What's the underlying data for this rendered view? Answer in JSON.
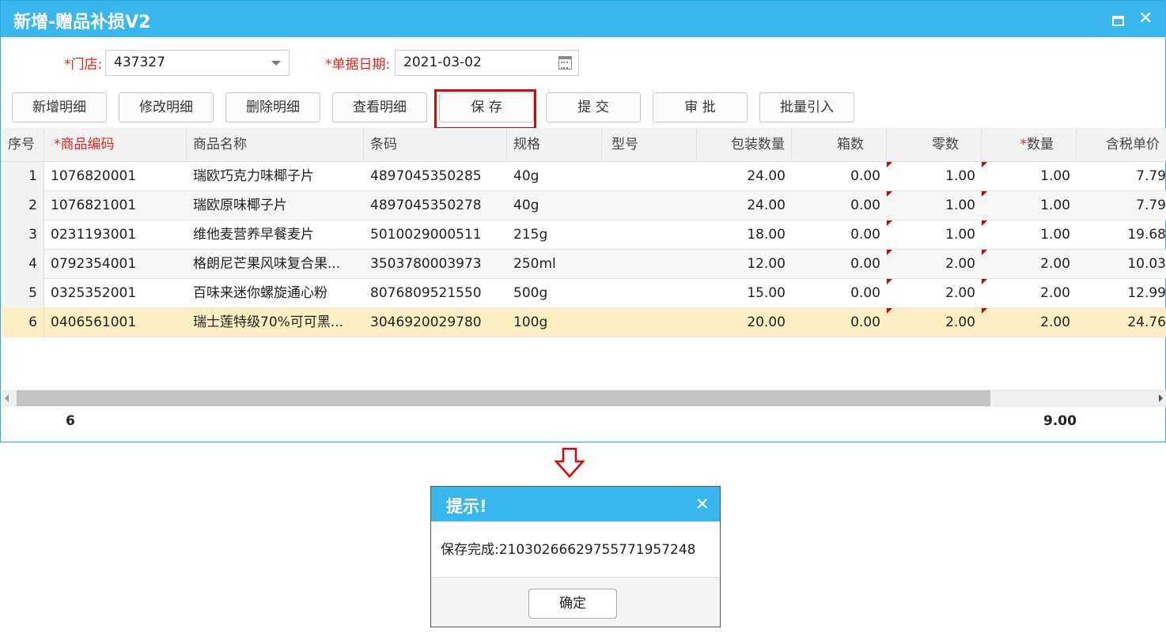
{
  "window": {
    "title": "新增-赠品补损V2"
  },
  "form": {
    "store_label": "门店:",
    "store_value": "437327",
    "date_label": "单据日期:",
    "date_value": "2021-03-02",
    "required_mark": "*"
  },
  "toolbar": {
    "add": "新增明细",
    "edit": "修改明细",
    "delete": "删除明细",
    "view": "查看明细",
    "save": "保 存",
    "submit": "提 交",
    "approve": "审 批",
    "import": "批量引入"
  },
  "grid": {
    "headers": {
      "idx": "序号",
      "code": "商品编码",
      "name": "商品名称",
      "barcode": "条码",
      "spec": "规格",
      "model": "型号",
      "pack": "包装数量",
      "box": "箱数",
      "loose": "零数",
      "qty": "数量",
      "price": "含税单价"
    },
    "rows": [
      {
        "idx": "1",
        "code": "1076820001",
        "name": "瑞欧巧克力味椰子片",
        "barcode": "4897045350285",
        "spec": "40g",
        "model": "",
        "pack": "24.00",
        "box": "0.00",
        "loose": "1.00",
        "qty": "1.00",
        "price": "7.79"
      },
      {
        "idx": "2",
        "code": "1076821001",
        "name": "瑞欧原味椰子片",
        "barcode": "4897045350278",
        "spec": "40g",
        "model": "",
        "pack": "24.00",
        "box": "0.00",
        "loose": "1.00",
        "qty": "1.00",
        "price": "7.79"
      },
      {
        "idx": "3",
        "code": "0231193001",
        "name": "维他麦营养早餐麦片",
        "barcode": "5010029000511",
        "spec": "215g",
        "model": "",
        "pack": "18.00",
        "box": "0.00",
        "loose": "1.00",
        "qty": "1.00",
        "price": "19.68"
      },
      {
        "idx": "4",
        "code": "0792354001",
        "name": "格朗尼芒果风味复合果...",
        "barcode": "3503780003973",
        "spec": "250ml",
        "model": "",
        "pack": "12.00",
        "box": "0.00",
        "loose": "2.00",
        "qty": "2.00",
        "price": "10.03"
      },
      {
        "idx": "5",
        "code": "0325352001",
        "name": "百味来迷你螺旋通心粉",
        "barcode": "8076809521550",
        "spec": "500g",
        "model": "",
        "pack": "15.00",
        "box": "0.00",
        "loose": "2.00",
        "qty": "2.00",
        "price": "12.99"
      },
      {
        "idx": "6",
        "code": "0406561001",
        "name": "瑞士莲特级70%可可黑...",
        "barcode": "3046920029780",
        "spec": "100g",
        "model": "",
        "pack": "20.00",
        "box": "0.00",
        "loose": "2.00",
        "qty": "2.00",
        "price": "24.76"
      }
    ],
    "footer": {
      "count": "6",
      "qty_total": "9.00"
    }
  },
  "dialog": {
    "title": "提示!",
    "message": "保存完成:2103026662975577195724​8",
    "ok": "确定"
  },
  "colors": {
    "title_bar": "#39b6ee",
    "required": "#e0261b",
    "selected_row": "#fdefc3",
    "highlight": "#e30000"
  }
}
